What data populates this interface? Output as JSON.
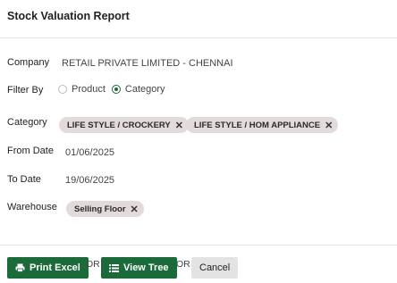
{
  "header": {
    "title": "Stock Valuation Report"
  },
  "form": {
    "company": {
      "label": "Company",
      "value": "RETAIL PRIVATE LIMITED - CHENNAI"
    },
    "filter_by": {
      "label": "Filter By",
      "options": [
        {
          "label": "Product",
          "checked": false
        },
        {
          "label": "Category",
          "checked": true
        }
      ]
    },
    "category": {
      "label": "Category",
      "chips": [
        "LIFE STYLE / CROCKERY",
        "LIFE STYLE / HOM APPLIANCE"
      ]
    },
    "from_date": {
      "label": "From Date",
      "value": "01/06/2025"
    },
    "to_date": {
      "label": "To Date",
      "value": "19/06/2025"
    },
    "warehouse": {
      "label": "Warehouse",
      "chips": [
        "Selling Floor"
      ]
    }
  },
  "footer": {
    "print_excel_label": "Print Excel",
    "or1": "OR",
    "view_tree_label": "View Tree",
    "or2": "OR",
    "cancel_label": "Cancel"
  },
  "colors": {
    "primary_green": "#1b6b3a",
    "chip_bg": "#e3dbdb"
  },
  "icons": {
    "print": "printer-icon",
    "tree": "list-icon",
    "remove": "close-icon"
  }
}
